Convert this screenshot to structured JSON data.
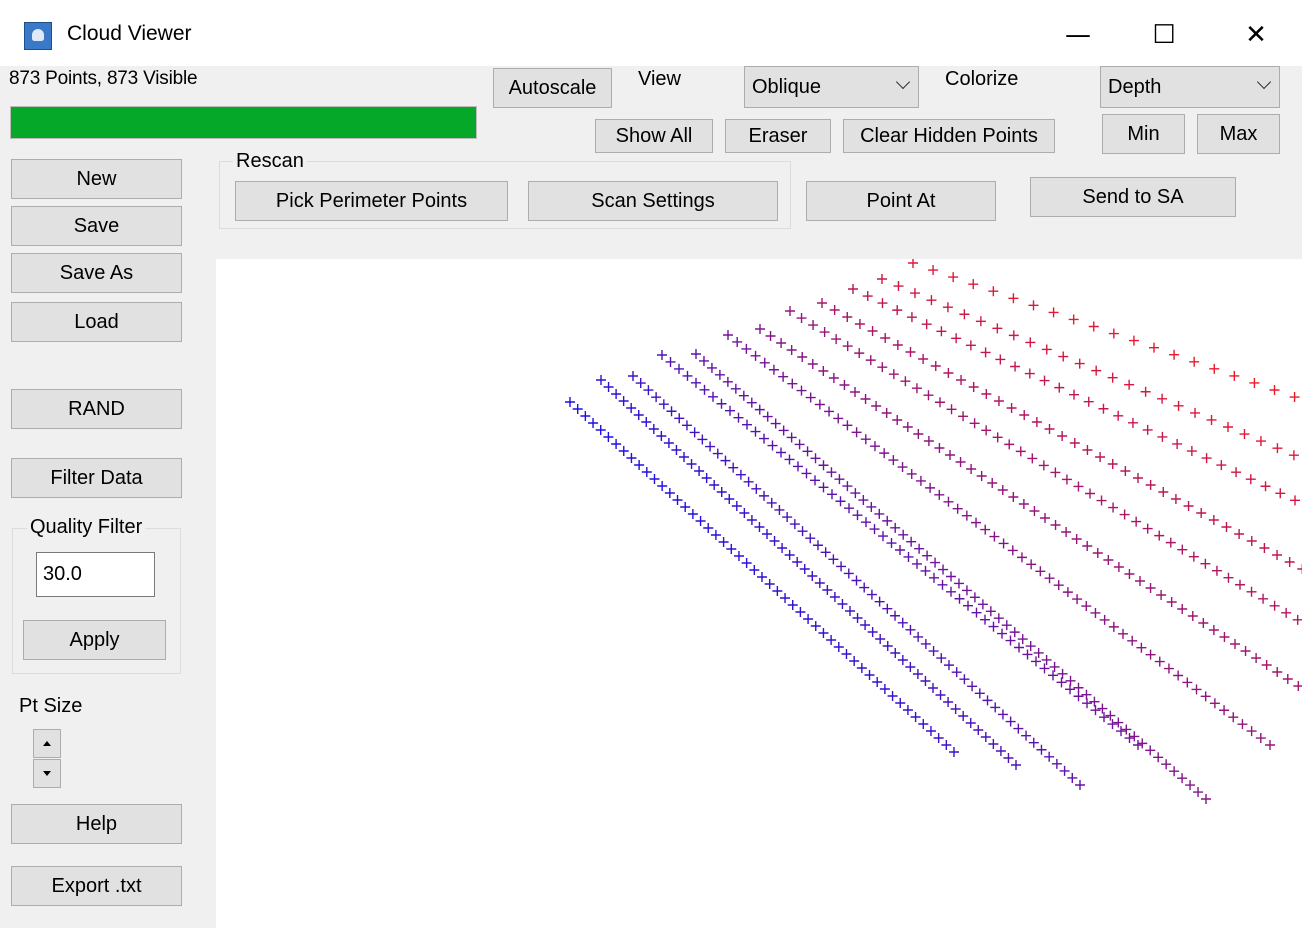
{
  "window": {
    "title": "Cloud Viewer",
    "minimize_glyph": "—",
    "maximize_glyph": "☐",
    "close_glyph": "✕"
  },
  "status": {
    "points_text": "873 Points, 873 Visible",
    "progress_fraction": 1.0,
    "progress_color": "#06a82a"
  },
  "toolbar": {
    "autoscale": "Autoscale",
    "view_label": "View",
    "view_value": "Oblique",
    "colorize_label": "Colorize",
    "colorize_value": "Depth",
    "show_all": "Show All",
    "eraser": "Eraser",
    "clear_hidden": "Clear Hidden Points",
    "min": "Min",
    "max": "Max"
  },
  "rescan": {
    "group_title": "Rescan",
    "pick_perimeter": "Pick Perimeter Points",
    "scan_settings": "Scan Settings"
  },
  "actions": {
    "point_at": "Point At",
    "send_to_sa": "Send to SA"
  },
  "sidebar": {
    "new": "New",
    "save": "Save",
    "save_as": "Save As",
    "load": "Load",
    "rand": "RAND",
    "filter_data": "Filter Data",
    "quality_filter_title": "Quality Filter",
    "quality_value": "30.0",
    "apply": "Apply",
    "pt_size_label": "Pt Size",
    "help": "Help",
    "export": "Export .txt"
  },
  "cloud": {
    "marker": "plus",
    "color_low": "#1a10e6",
    "color_high": "#ff1a1a"
  }
}
